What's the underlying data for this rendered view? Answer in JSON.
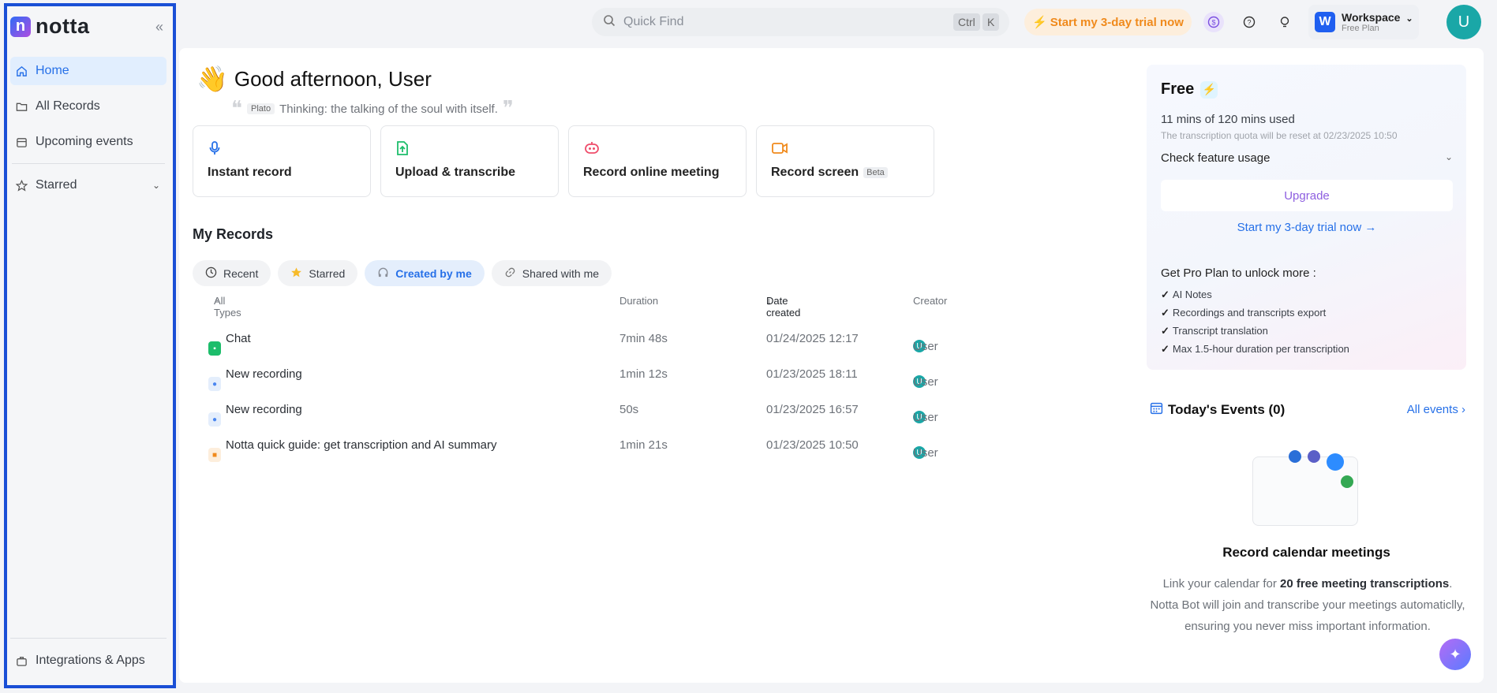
{
  "app": {
    "logo_letter": "n",
    "logo_text": "notta",
    "collapse_icon": "double-chevron-left-icon"
  },
  "sidebar": {
    "items": [
      {
        "label": "Home",
        "icon": "home-icon",
        "active": true
      },
      {
        "label": "All Records",
        "icon": "folder-icon"
      },
      {
        "label": "Upcoming events",
        "icon": "calendar-icon"
      }
    ],
    "starred_label": "Starred",
    "bottom_label": "Integrations & Apps"
  },
  "topbar": {
    "search_placeholder": "Quick Find",
    "kbd_ctrl": "Ctrl",
    "kbd_k": "K",
    "trial_label": "Start my 3-day trial now",
    "workspace_badge": "W",
    "workspace_name": "Workspace",
    "workspace_plan": "Free Plan",
    "avatar": "U"
  },
  "greeting": {
    "emoji": "👋",
    "text": "Good afternoon, User",
    "quote_author": "Plato",
    "quote_text": "Thinking: the talking of the soul with itself."
  },
  "actions": [
    {
      "label": "Instant record",
      "icon": "microphone-icon",
      "color": "#2670e8"
    },
    {
      "label": "Upload & transcribe",
      "icon": "upload-file-icon",
      "color": "#1dbd6b"
    },
    {
      "label": "Record online meeting",
      "icon": "bot-icon",
      "color": "#ef4d6b"
    },
    {
      "label": "Record screen",
      "icon": "video-camera-icon",
      "color": "#f08a1c",
      "badge": "Beta"
    }
  ],
  "records": {
    "title": "My Records",
    "filters": [
      {
        "label": "Recent",
        "icon": "clock-icon"
      },
      {
        "label": "Starred",
        "icon": "star-icon"
      },
      {
        "label": "Created by me",
        "icon": "headphones-icon",
        "active": true
      },
      {
        "label": "Shared with me",
        "icon": "link-icon"
      }
    ],
    "columns": {
      "type": "All Types",
      "duration": "Duration",
      "date": "Date created",
      "creator": "Creator"
    },
    "rows": [
      {
        "name": "Chat",
        "icon_color": "#1dbd6b",
        "duration": "7min 48s",
        "date": "01/24/2025 12:17",
        "creator": "User"
      },
      {
        "name": "New recording",
        "icon_color": "#4a86f0",
        "duration": "1min 12s",
        "date": "01/23/2025 18:11",
        "creator": "User"
      },
      {
        "name": "New recording",
        "icon_color": "#4a86f0",
        "duration": "50s",
        "date": "01/23/2025 16:57",
        "creator": "User"
      },
      {
        "name": "Notta quick guide: get transcription and AI summary",
        "icon_color": "#f08a1c",
        "duration": "1min 21s",
        "date": "01/23/2025 10:50",
        "creator": "User"
      }
    ],
    "creator_initial": "U"
  },
  "plan": {
    "title": "Free",
    "used": "11 mins of 120 mins used",
    "reset": "The transcription quota will be reset at 02/23/2025 10:50",
    "check_usage": "Check feature usage",
    "upgrade": "Upgrade",
    "trial_link": "Start my 3-day trial now →",
    "pro_title": "Get Pro Plan to unlock more :",
    "pro_items": [
      "AI Notes",
      "Recordings and transcripts export",
      "Transcript translation",
      "Max 1.5-hour duration per transcription"
    ]
  },
  "events": {
    "title": "Today's Events (0)",
    "all_events": "All events",
    "cal_title": "Record calendar meetings",
    "desc_prefix": "Link your calendar for ",
    "desc_bold": "20 free meeting transcriptions",
    "desc_suffix": ". Notta Bot will join and transcribe your meetings automaticlly, ensuring you never miss important information."
  }
}
